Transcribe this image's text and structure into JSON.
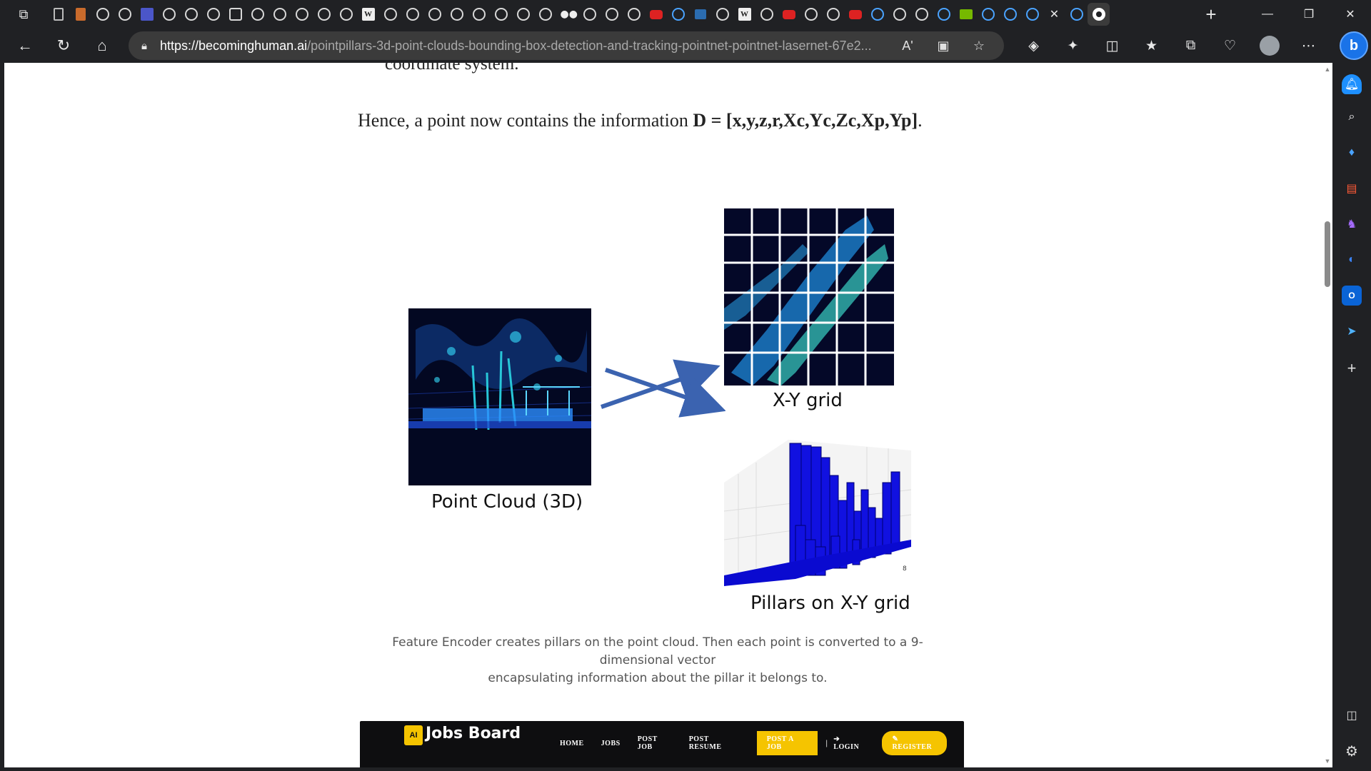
{
  "browser": {
    "tabs": [
      {
        "icon": "doc"
      },
      {
        "icon": "ora"
      },
      {
        "icon": "gh"
      },
      {
        "icon": "gh"
      },
      {
        "icon": "ms"
      },
      {
        "icon": "gh"
      },
      {
        "icon": "gh"
      },
      {
        "icon": "gh"
      },
      {
        "icon": "sq"
      },
      {
        "icon": "gh"
      },
      {
        "icon": "gh"
      },
      {
        "icon": "gh"
      },
      {
        "icon": "gh"
      },
      {
        "icon": "gh"
      },
      {
        "icon": "w"
      },
      {
        "icon": "gh"
      },
      {
        "icon": "gh"
      },
      {
        "icon": "gh"
      },
      {
        "icon": "gh"
      },
      {
        "icon": "gh"
      },
      {
        "icon": "gh"
      },
      {
        "icon": "gh"
      },
      {
        "icon": "gh"
      },
      {
        "icon": "med"
      },
      {
        "icon": "gh"
      },
      {
        "icon": "gh"
      },
      {
        "icon": "gh"
      },
      {
        "icon": "yt"
      },
      {
        "icon": "srch"
      },
      {
        "icon": "ieee"
      },
      {
        "icon": "gh"
      },
      {
        "icon": "w"
      },
      {
        "icon": "gh"
      },
      {
        "icon": "yt"
      },
      {
        "icon": "gh"
      },
      {
        "icon": "gh"
      },
      {
        "icon": "yt"
      },
      {
        "icon": "srch"
      },
      {
        "icon": "gh"
      },
      {
        "icon": "gh"
      },
      {
        "icon": "srch"
      },
      {
        "icon": "nv"
      },
      {
        "icon": "srch"
      },
      {
        "icon": "srch"
      },
      {
        "icon": "srch"
      },
      {
        "icon": "close"
      },
      {
        "icon": "srch"
      },
      {
        "icon": "gh-active"
      }
    ],
    "url_domain": "https://becominghuman.ai",
    "url_path": "/pointpillars-3d-point-clouds-bounding-box-detection-and-tracking-pointnet-pointnet-lasernet-67e2...",
    "new_tab_label": "+",
    "read_aloud_label": "Aʹ"
  },
  "article": {
    "fragment": "coordinate system.",
    "para_prefix": "Hence, a point now contains the information ",
    "para_bold": "D = [x,y,z,r,Xc,Yc,Zc,Xp,Yp]",
    "para_suffix": ".",
    "figure": {
      "label_point_cloud": "Point Cloud (3D)",
      "label_xy_grid": "X-Y grid",
      "label_pillars": "Pillars on X-Y grid",
      "pillar_axis_tick": "8"
    },
    "caption_line1": "Feature Encoder creates pillars on the point cloud. Then each point is converted to a 9-dimensional vector",
    "caption_line2": "encapsulating information about the pillar it belongs to."
  },
  "ad": {
    "logo": "AI",
    "brand": "Jobs Board",
    "nav": [
      "HOME",
      "JOBS",
      "POST JOB",
      "POST RESUME"
    ],
    "post_button": "POST A JOB",
    "login": "➔ LOGIN",
    "register": "✎ REGISTER"
  }
}
